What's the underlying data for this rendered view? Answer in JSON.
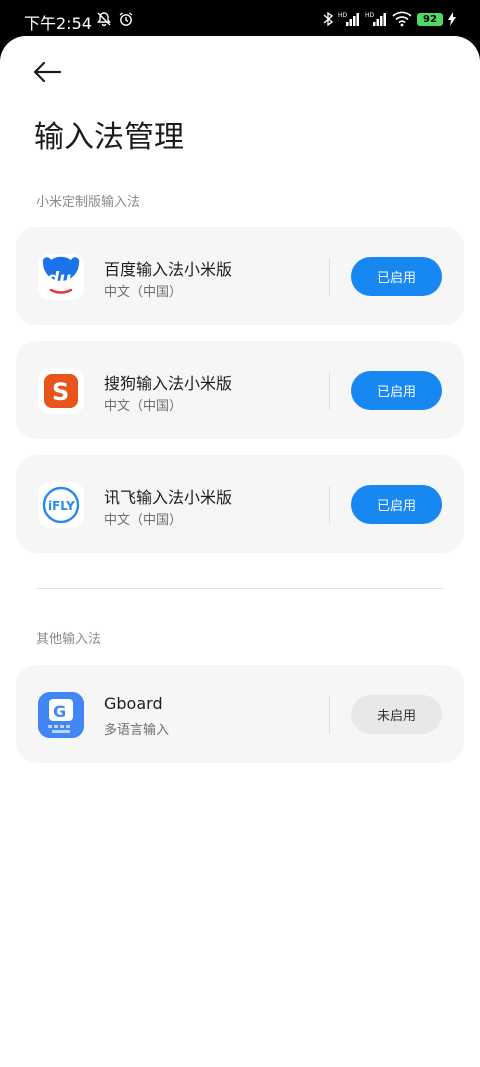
{
  "status_bar": {
    "time": "下午2:54",
    "battery": "92",
    "icons": [
      "bell-off-icon",
      "alarm-icon",
      "bluetooth-icon",
      "signal-hd-icon",
      "signal-hd-icon",
      "wifi-icon",
      "battery-icon",
      "charging-icon"
    ]
  },
  "header": {
    "back_icon": "back-arrow-icon",
    "title": "输入法管理"
  },
  "sections": {
    "xiaomi": {
      "label": "小米定制版输入法"
    },
    "other": {
      "label": "其他输入法"
    }
  },
  "xiaomi_ims": [
    {
      "name": "百度输入法小米版",
      "lang": "中文（中国）",
      "state": "已启用",
      "icon": "baidu-du-icon"
    },
    {
      "name": "搜狗输入法小米版",
      "lang": "中文（中国）",
      "state": "已启用",
      "icon": "sogou-s-icon"
    },
    {
      "name": "讯飞输入法小米版",
      "lang": "中文（中国）",
      "state": "已启用",
      "icon": "ifly-icon"
    }
  ],
  "other_ims": [
    {
      "name": "Gboard",
      "lang": "多语言输入",
      "state": "未启用",
      "icon": "gboard-icon"
    }
  ],
  "colors": {
    "accent": "#1787f2",
    "disabled_button": "#e8e8e8",
    "card": "#f6f6f6",
    "sogou": "#e8551b",
    "baidu": "#1a73e8"
  }
}
